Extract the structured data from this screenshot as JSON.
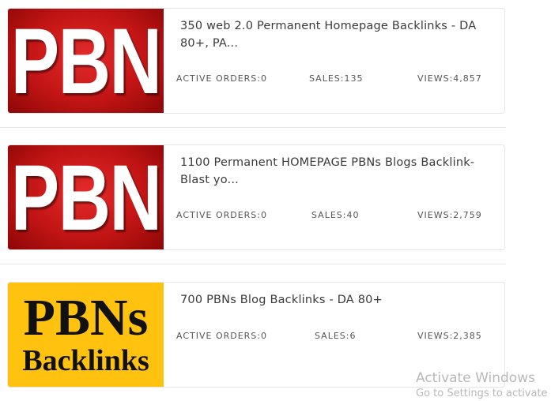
{
  "listings": [
    {
      "thumbnail_text": "PBN",
      "title": "350 web 2.0 Permanent Homepage Backlinks - DA 80+, PA...",
      "active_orders": "ACTIVE ORDERS:0",
      "sales": "SALES:135",
      "views": "VIEWS:4,857"
    },
    {
      "thumbnail_text": "PBN",
      "title": "1100 Permanent HOMEPAGE PBNs Blogs Backlink- Blast yo...",
      "active_orders": "ACTIVE ORDERS:0",
      "sales": "SALES:40",
      "views": "VIEWS:2,759"
    },
    {
      "thumbnail_text_line1": "PBNs",
      "thumbnail_text_line2": "Backlinks",
      "title": "700 PBNs Blog Backlinks - DA 80+",
      "active_orders": "ACTIVE ORDERS:0",
      "sales": "SALES:6",
      "views": "VIEWS:2,385"
    }
  ],
  "watermark": {
    "line1": "Activate Windows",
    "line2": "Go to Settings to activate"
  }
}
